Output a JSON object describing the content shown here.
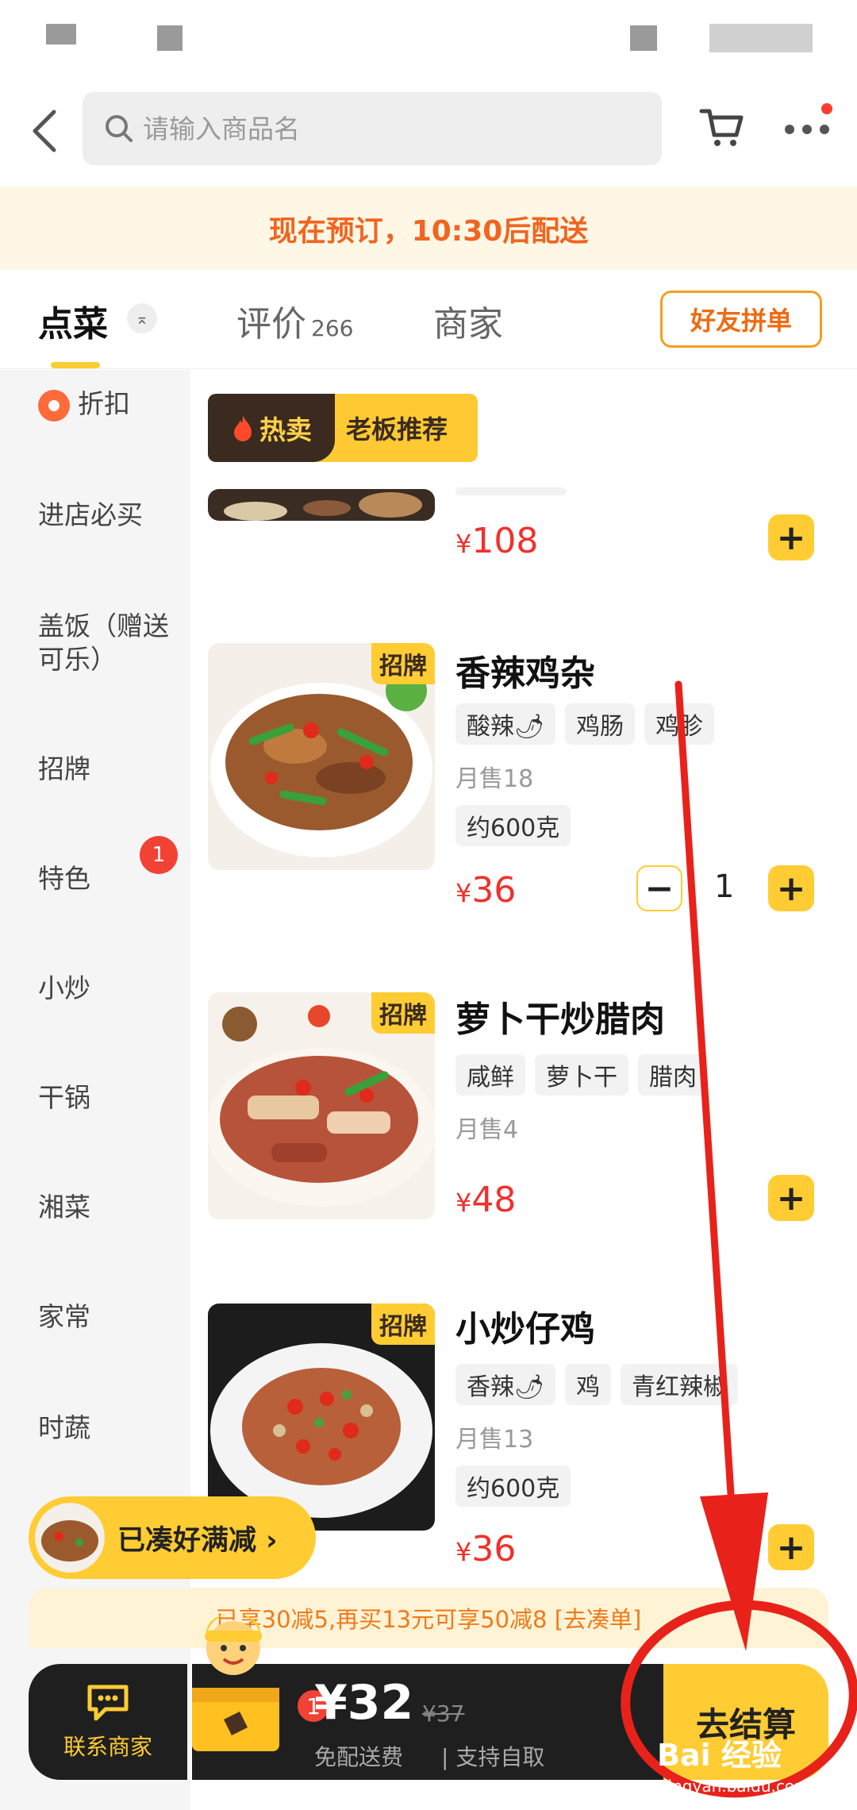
{
  "header": {
    "search_placeholder": "请输入商品名"
  },
  "banner": {
    "text": "现在预订，10:30后配送"
  },
  "tabs": {
    "order": "点菜",
    "reviews": "评价",
    "reviews_count": "266",
    "merchant": "商家",
    "group_button": "好友拼单",
    "collapse_glyph": "⌅"
  },
  "sidebar": {
    "items": [
      "折扣",
      "进店必买",
      "盖饭（赠送可乐）",
      "招牌",
      "特色",
      "小炒",
      "干锅",
      "湘菜",
      "家常",
      "时蔬"
    ],
    "badge": "1"
  },
  "section": {
    "hot": "热卖",
    "recommend": "老板推荐"
  },
  "dishes": [
    {
      "price": "108",
      "currency": "¥"
    },
    {
      "name": "香辣鸡杂",
      "badge": "招牌",
      "tags": [
        "酸辣🌶",
        "鸡肠",
        "鸡胗"
      ],
      "sales": "月售18",
      "weight": "约600克",
      "price": "36",
      "currency": "¥",
      "quantity": "1"
    },
    {
      "name": "萝卜干炒腊肉",
      "badge": "招牌",
      "tags": [
        "咸鲜",
        "萝卜干",
        "腊肉"
      ],
      "sales": "月售4",
      "price": "48",
      "currency": "¥"
    },
    {
      "name": "小炒仔鸡",
      "badge": "招牌",
      "tags": [
        "香辣🌶",
        "鸡",
        "青红辣椒"
      ],
      "sales": "月售13",
      "weight": "约600克",
      "price": "36",
      "currency": "¥"
    }
  ],
  "promo": {
    "pill_text": "已凑好满减 ›",
    "discount_text": "已享30减5,再买13元可享50减8  [去凑单]"
  },
  "bottom_bar": {
    "contact_label": "联系商家",
    "cart_badge": "1",
    "total": "¥32",
    "original": "¥37",
    "free_delivery": "免配送费",
    "self_pickup": "| 支持自取",
    "checkout": "去结算"
  },
  "watermark": {
    "main": "Bai 经验",
    "sub": "jingyan.baidu.com"
  },
  "colors": {
    "accent": "#ffcc33",
    "price": "#f0302c",
    "banner_text": "#f0651f",
    "annotation": "#e8221a"
  }
}
